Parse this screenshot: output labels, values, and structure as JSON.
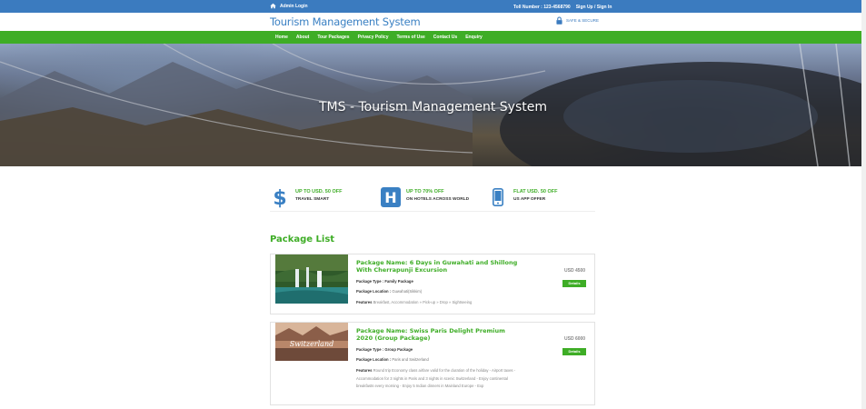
{
  "topbar": {
    "admin_login": "Admin Login",
    "toll_number": "Toll Number : 123-4568790",
    "signup": "Sign Up / Sign In"
  },
  "header": {
    "logo": "Tourism Management System",
    "secure": "SAFE & SECURE"
  },
  "nav": {
    "items": [
      "Home",
      "About",
      "Tour Packages",
      "Privacy Policy",
      "Terms of Use",
      "Contact Us",
      "Enquiry"
    ]
  },
  "hero": {
    "title": "TMS - Tourism Management System"
  },
  "offers": [
    {
      "title": "UP TO USD. 50 OFF",
      "subtitle": "TRAVEL SMART",
      "icon": "dollar-icon"
    },
    {
      "title": "UP TO 70% OFF",
      "subtitle": "ON HOTELS ACROSS WORLD",
      "icon": "hotel-icon"
    },
    {
      "title": "FLAT USD. 50 OFF",
      "subtitle": "US APP OFFER",
      "icon": "mobile-icon"
    }
  ],
  "packages": {
    "title": "Package List",
    "items": [
      {
        "name": "Package Name: 6 Days in Guwahati and Shillong With Cherrapunji Excursion",
        "type_label": "Package Type :",
        "type": "Family Package",
        "location_label": "Package Location :",
        "location": "Guwahati(Sikkim)",
        "features_label": "Features",
        "features": "Breakfast, Accommodation » Pick-up » Drop » Sightseeing",
        "price": "USD 4500",
        "button": "Details"
      },
      {
        "name": "Package Name: Swiss Paris Delight Premium 2020 (Group Package)",
        "type_label": "Package Type :",
        "type": "Group Package",
        "location_label": "Package Location :",
        "location": "Paris and Switzerland",
        "features_label": "Features",
        "features": "Round trip Economy class airfare valid for the duration of the holiday - Airport taxes - Accommodation for 3 nights in Paris and 3 nights in scenic Switzerland - Enjoy continental breakfasts every morning - Enjoy 5 Indian dinners in Mainland Europe - Exp",
        "price": "USD 6000",
        "button": "Details",
        "image_text": "Switzerland"
      }
    ]
  }
}
